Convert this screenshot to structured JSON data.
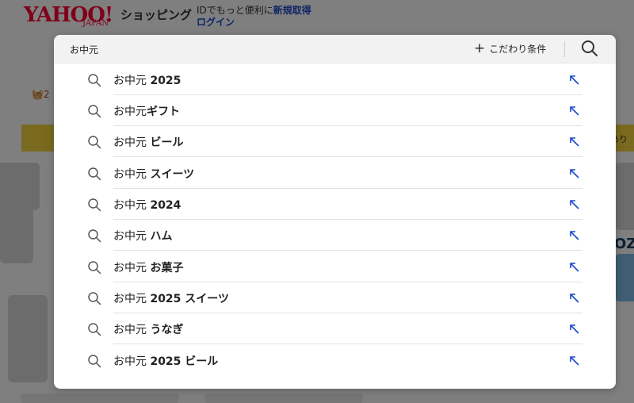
{
  "background": {
    "logo": "YAHOO!",
    "logo_sub": "JAPAN",
    "shop_title": "ショッピング",
    "login_hint_prefix": "IDでもっと便利に",
    "login_hint_strong": "新規取得",
    "login_link": "ログイン",
    "cart_text": "2",
    "banner_text": "あり",
    "right_text": "OZ"
  },
  "search": {
    "query": "お中元",
    "filter_label": "こだわり条件"
  },
  "suggestions": [
    {
      "base": "お中元 ",
      "rest": "2025"
    },
    {
      "base": "お中元",
      "rest": "ギフト"
    },
    {
      "base": "お中元 ",
      "rest": "ビール"
    },
    {
      "base": "お中元 ",
      "rest": "スイーツ"
    },
    {
      "base": "お中元 ",
      "rest": "2024"
    },
    {
      "base": "お中元 ",
      "rest": "ハム"
    },
    {
      "base": "お中元 ",
      "rest": "お菓子"
    },
    {
      "base": "お中元 ",
      "rest": "2025 スイーツ"
    },
    {
      "base": "お中元 ",
      "rest": "うなぎ"
    },
    {
      "base": "お中元 ",
      "rest": "2025 ビール"
    }
  ],
  "colors": {
    "accent_blue": "#1a49c9",
    "yahoo_red": "#ff0033",
    "banner_yellow": "#f4d43f"
  },
  "icons": {
    "suggestion_icon": "search-icon",
    "fill_icon": "arrow-up-left-icon",
    "filter_icon": "plus-icon"
  }
}
